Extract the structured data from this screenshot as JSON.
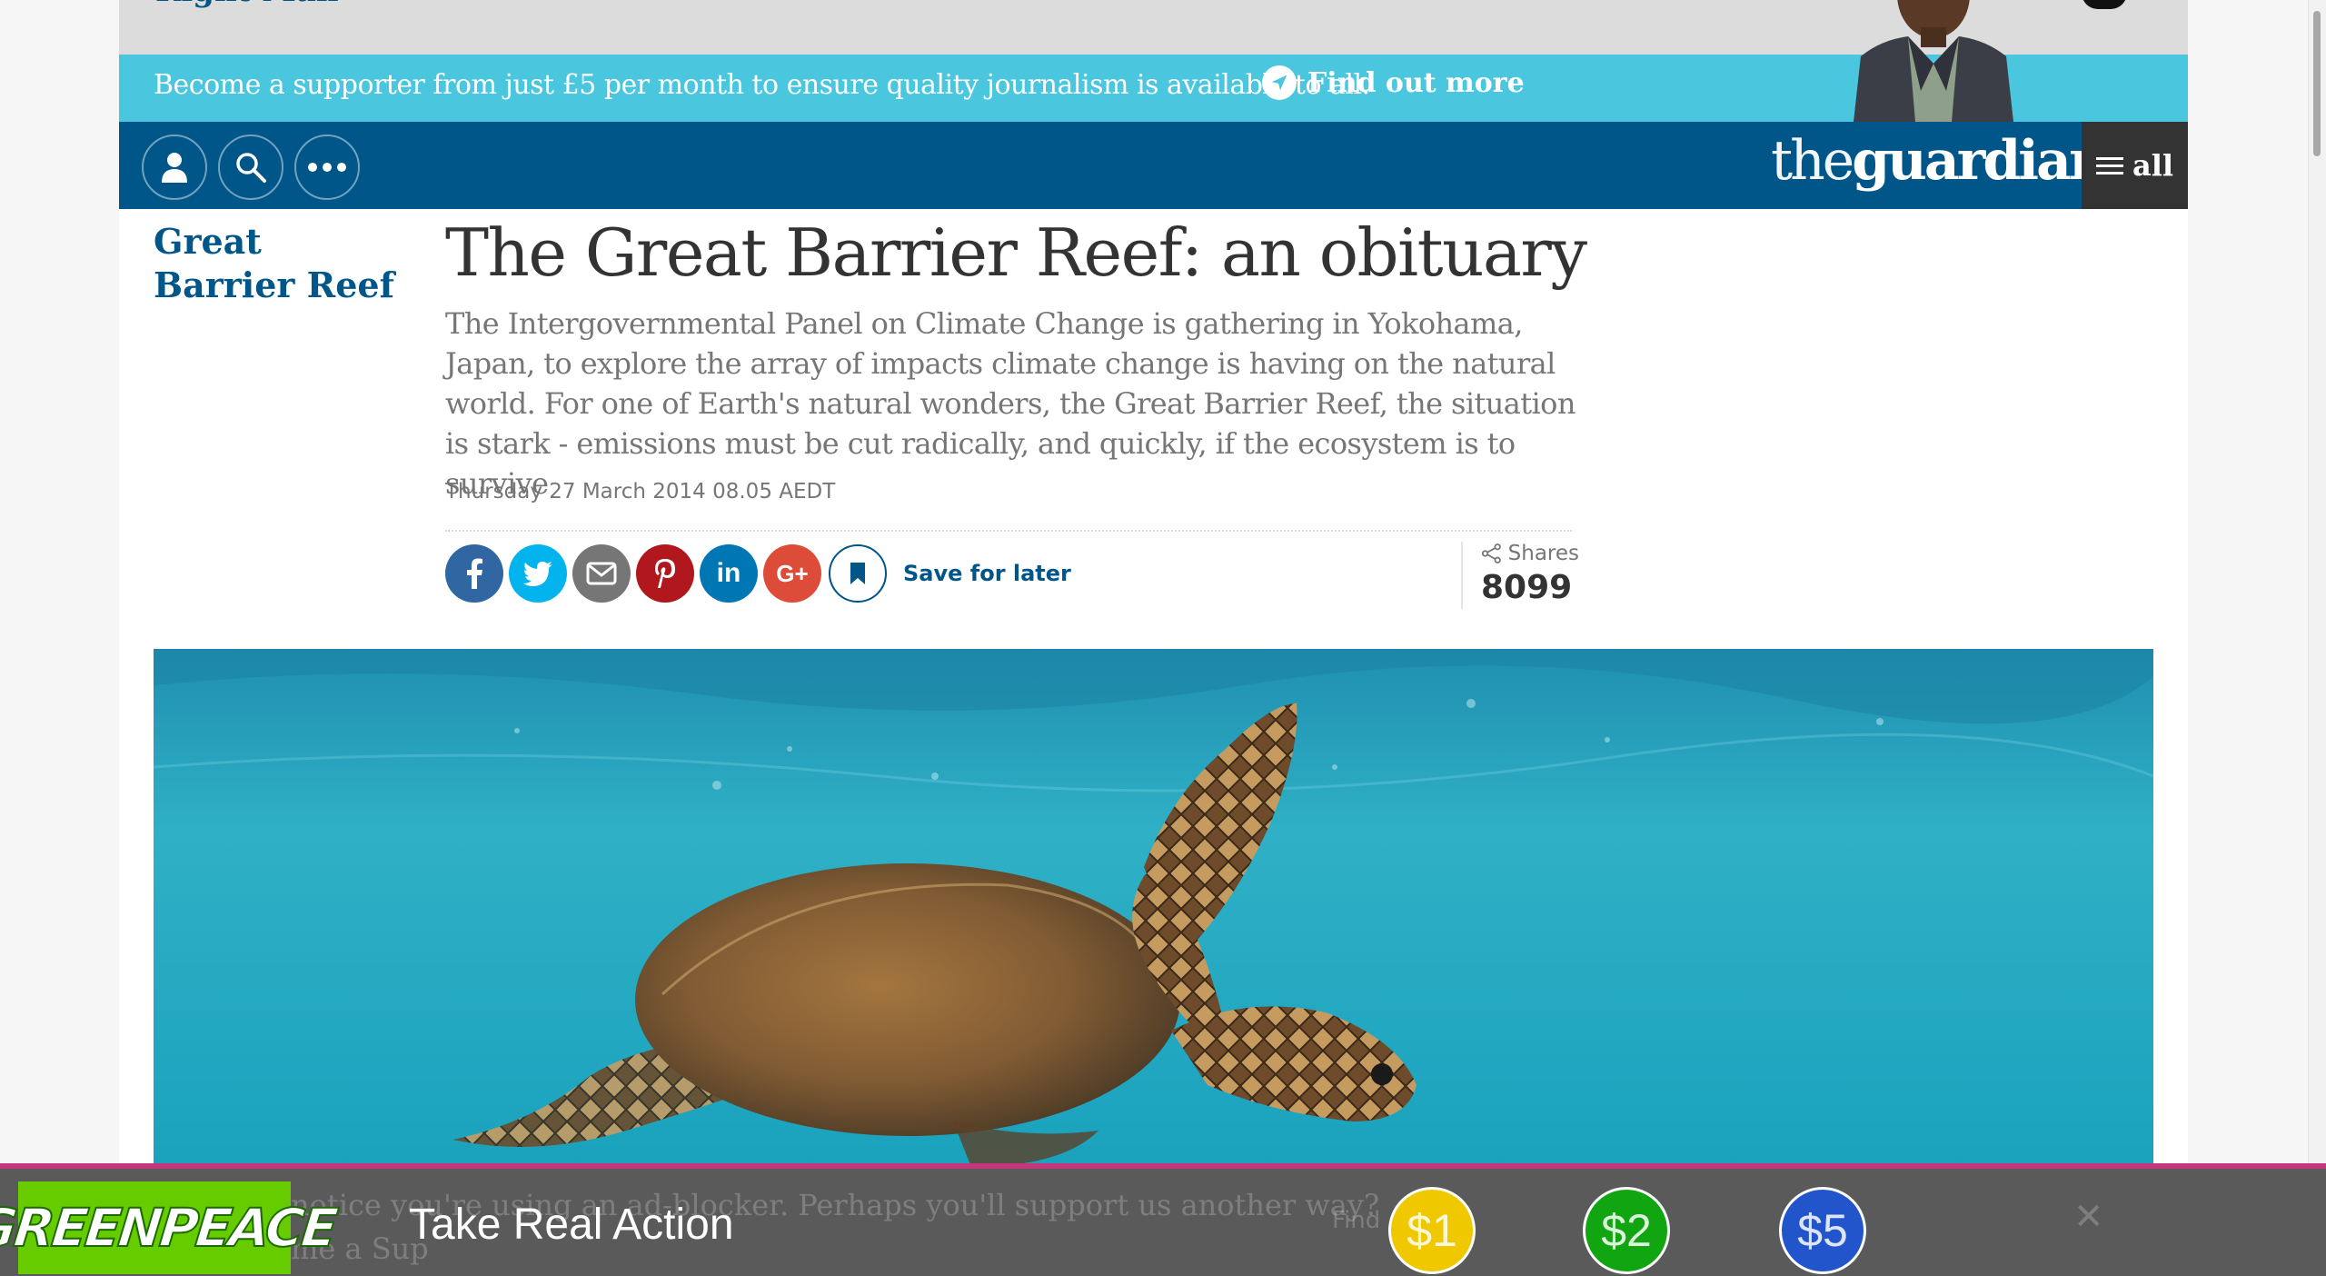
{
  "top_ad": {
    "partial_text": "Right Man"
  },
  "supporter": {
    "message": "Become a supporter from just £5 per month to ensure quality journalism is available to all.",
    "link_label": "Find out more"
  },
  "nav": {
    "logo_the": "the",
    "logo_guardian": "guardian",
    "all_label": "all"
  },
  "article": {
    "section": "Great Barrier Reef",
    "headline": "The Great Barrier Reef: an obituary",
    "standfirst": "The Intergovernmental Panel on Climate Change is gathering in Yokohama, Japan, to explore the array of impacts climate change is having on the natural world. For one of Earth's natural wonders, the Great Barrier Reef, the situation is stark - emissions must be cut radically, and quickly, if the ecosystem is to survive",
    "date": "Thursday 27 March 2014 08.05 AEDT"
  },
  "share": {
    "save_label": "Save for later",
    "shares_label": "Shares",
    "shares_count": "8099",
    "colors": {
      "facebook": "#3067a3",
      "twitter": "#03b3ee",
      "email": "#767676",
      "pinterest": "#b0181e",
      "linkedin": "#0077b5",
      "googleplus": "#dd4b39"
    }
  },
  "bottom_ad": {
    "brand": "GREENPEACE",
    "headline": "Take Real Action",
    "ghost_line1": "notice you're using an ad-blocker. Perhaps you'll support us another way?",
    "ghost_line2": "me a Sup",
    "ghost_find": "Find",
    "amounts": [
      "$1",
      "$2",
      "$5"
    ],
    "amount_colors": [
      "#f0c800",
      "#11a511",
      "#2255cc"
    ]
  }
}
